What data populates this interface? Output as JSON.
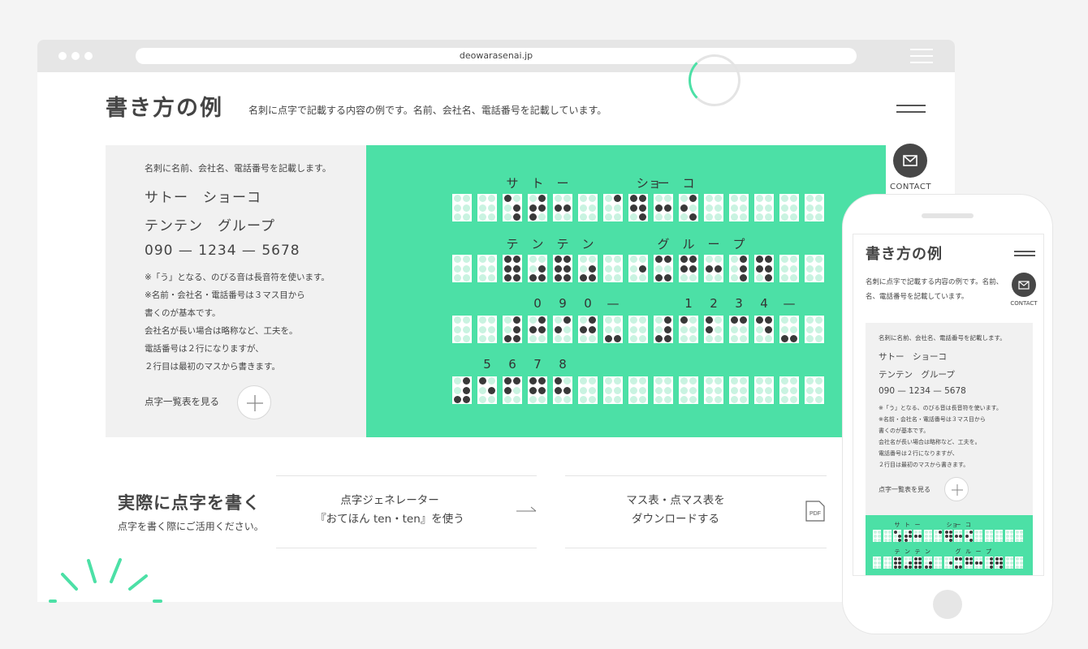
{
  "browser": {
    "url": "deowarasenai.jp"
  },
  "header": {
    "title": "書き方の例",
    "lead": "名刺に点字で記載する内容の例です。名前、会社名、電話番号を記載しています。",
    "contact_label": "CONTACT"
  },
  "example": {
    "intro": "名刺に名前、会社名、電話番号を記載します。",
    "lines": [
      "サトー　ショーコ",
      "テンテン　グループ",
      "090 — 1234 — 5678"
    ],
    "notes": [
      "※「う」となる、のびる音は長音符を使います。",
      "※名前・会社名・電話番号は３マス目から",
      "書くのが基本です。",
      "会社名が長い場合は略称など、工夫を。",
      "電話番号は２行になりますが、",
      "２行目は最初のマスから書きます。"
    ],
    "link_label": "点字一覧表を見る"
  },
  "braille": {
    "rows": [
      {
        "labels": [
          "",
          "",
          "サ",
          "ト",
          "ー",
          "",
          "",
          "ショ",
          "ー",
          "コ",
          "",
          "",
          "",
          "",
          ""
        ],
        "cells": [
          [],
          [],
          [
            1,
            5,
            6
          ],
          [
            2,
            3,
            4,
            5
          ],
          [
            2,
            5
          ],
          [],
          [
            4
          ],
          [
            1,
            2,
            4,
            5,
            6
          ],
          [
            2,
            5
          ],
          [
            2,
            4,
            6
          ],
          [],
          [],
          [],
          [],
          []
        ]
      },
      {
        "labels": [
          "",
          "",
          "テ",
          "ン",
          "テ",
          "ン",
          "",
          "",
          "グ",
          "ル",
          "ー",
          "プ",
          "",
          "",
          ""
        ],
        "cells": [
          [],
          [],
          [
            1,
            2,
            3,
            4,
            5,
            6
          ],
          [
            3,
            5,
            6
          ],
          [
            1,
            2,
            3,
            4,
            5,
            6
          ],
          [
            3,
            5,
            6
          ],
          [],
          [
            5
          ],
          [
            1,
            3,
            4,
            6
          ],
          [
            1,
            2,
            4,
            5
          ],
          [
            2,
            5
          ],
          [
            4,
            5,
            6
          ],
          [
            1,
            2,
            4,
            5,
            6
          ],
          [],
          []
        ]
      },
      {
        "labels": [
          "",
          "",
          "",
          "0",
          "9",
          "0",
          "—",
          "",
          "",
          "1",
          "2",
          "3",
          "4",
          "—",
          ""
        ],
        "cells": [
          [],
          [],
          [
            3,
            4,
            5,
            6
          ],
          [
            2,
            4,
            5
          ],
          [
            2,
            4
          ],
          [
            2,
            4,
            5
          ],
          [
            3,
            6
          ],
          [],
          [
            3,
            4,
            5,
            6
          ],
          [
            1
          ],
          [
            1,
            2
          ],
          [
            1,
            4
          ],
          [
            1,
            4,
            5
          ],
          [
            3,
            6
          ],
          []
        ]
      },
      {
        "labels": [
          "",
          "5",
          "6",
          "7",
          "8",
          "",
          "",
          "",
          "",
          "",
          "",
          "",
          "",
          "",
          ""
        ],
        "cells": [
          [
            3,
            4,
            5,
            6
          ],
          [
            1,
            5
          ],
          [
            1,
            2,
            4
          ],
          [
            1,
            2,
            4,
            5
          ],
          [
            1,
            2,
            5
          ],
          [],
          [],
          [],
          [],
          [],
          [],
          [],
          [],
          [],
          []
        ]
      }
    ]
  },
  "practical": {
    "title": "実際に点字を書く",
    "subtitle": "点字を書く際にご活用ください。",
    "cards": [
      {
        "line1": "点字ジェネレーター",
        "line2": "『おてほん ten・ten』を使う"
      },
      {
        "line1": "マス表・点マス表を",
        "line2": "ダウンロードする"
      }
    ],
    "pdf_label": "PDF"
  },
  "phone": {
    "title": "書き方の例",
    "lead_line1": "名刺に点字で記載する内容の例です。名前、",
    "lead_line2": "名、電話番号を記載しています。",
    "contact_label": "CONTACT",
    "link_label": "点字一覧表を見る"
  },
  "colors": {
    "accent_green": "#4ce0a6",
    "dot_dark": "#393939",
    "dot_light": "#c9f3e1"
  }
}
